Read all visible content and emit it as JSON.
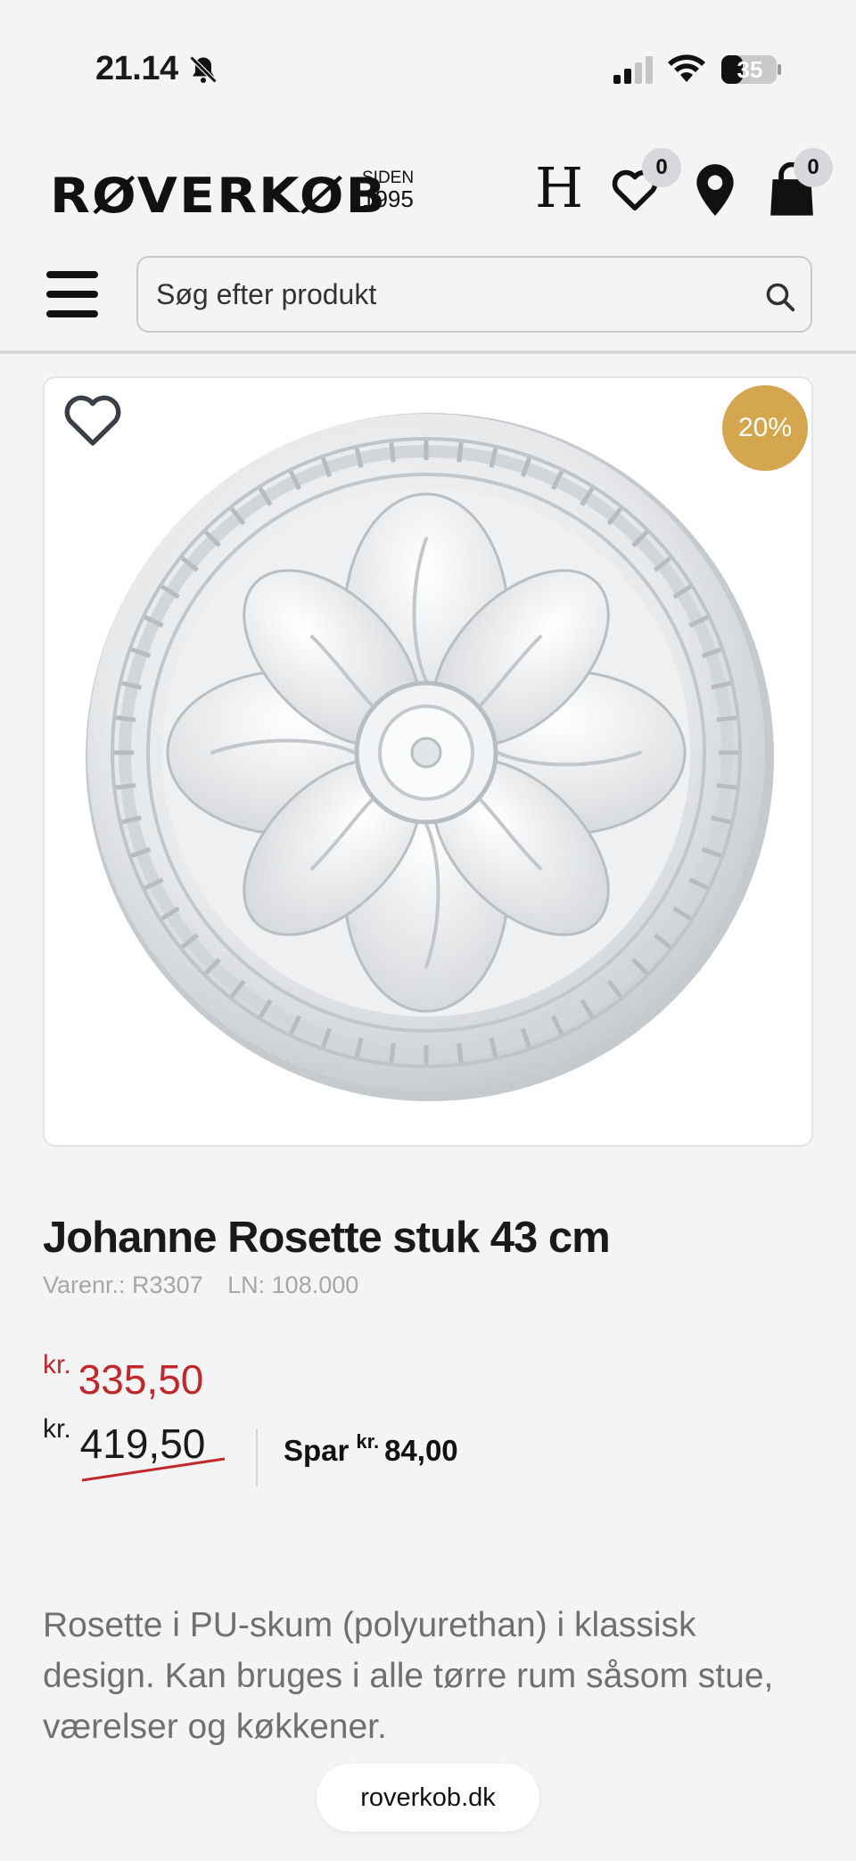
{
  "status_bar": {
    "time": "21.14",
    "battery": "35",
    "icons": [
      "bell-slash-icon",
      "signal-icon",
      "wifi-icon",
      "battery-icon"
    ]
  },
  "header": {
    "logo_text": "RØVERKØB",
    "logo_since": "SIDEN",
    "logo_year": "1995",
    "brand_mark": "H",
    "wishlist_count": "0",
    "cart_count": "0",
    "icons": [
      "heart-icon",
      "location-pin-icon",
      "shopping-bag-icon"
    ]
  },
  "search": {
    "placeholder": "Søg efter produkt"
  },
  "product": {
    "discount_badge": "20%",
    "title": "Johanne Rosette stuk 43 cm",
    "sku_label": "Varenr.: R3307",
    "ln_label": "LN: 108.000",
    "currency": "kr.",
    "price_now": "335,50",
    "price_old": "419,50",
    "save_label": "Spar",
    "save_amount": "84,00",
    "description": "Rosette i PU-skum (polyurethan) i klassisk design. Kan bruges i alle tørre rum såsom stue, værelser og køkkener."
  },
  "browser": {
    "url": "roverkob.dk"
  },
  "colors": {
    "accent_price": "#c0292b",
    "discount_badge": "#d4a64e",
    "background": "#f4f4f4"
  }
}
